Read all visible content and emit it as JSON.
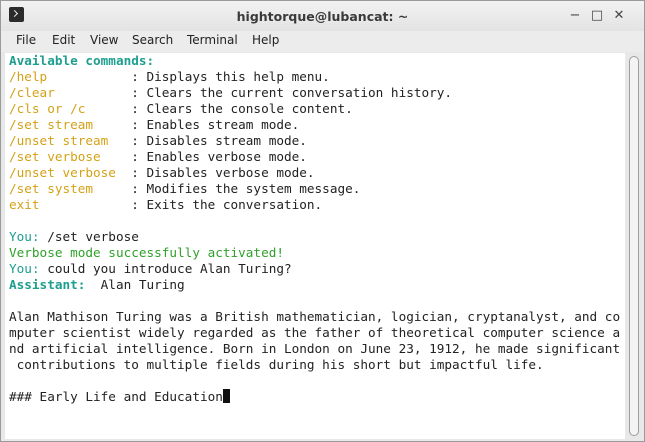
{
  "window": {
    "title": "hightorque@lubancat: ~",
    "controls": {
      "minimize": "−",
      "maximize": "□",
      "close": "✕"
    }
  },
  "menubar": [
    "File",
    "Edit",
    "View",
    "Search",
    "Terminal",
    "Help"
  ],
  "terminal": {
    "header": "Available commands:",
    "commands": [
      {
        "cmd": "/help           ",
        "desc": ": Displays this help menu."
      },
      {
        "cmd": "/clear          ",
        "desc": ": Clears the current conversation history."
      },
      {
        "cmd": "/cls or /c      ",
        "desc": ": Clears the console content."
      },
      {
        "cmd": "/set stream     ",
        "desc": ": Enables stream mode."
      },
      {
        "cmd": "/unset stream   ",
        "desc": ": Disables stream mode."
      },
      {
        "cmd": "/set verbose    ",
        "desc": ": Enables verbose mode."
      },
      {
        "cmd": "/unset verbose  ",
        "desc": ": Disables verbose mode."
      },
      {
        "cmd": "/set system     ",
        "desc": ": Modifies the system message."
      },
      {
        "cmd": "exit            ",
        "desc": ": Exits the conversation."
      }
    ],
    "you_label": "You:",
    "input1": " /set verbose",
    "verbose_msg": "Verbose mode successfully activated!",
    "input2": " could you introduce Alan Turing?",
    "assistant_label": "Assistant:",
    "assistant_text": "  Alan Turing",
    "paragraph": [
      "Alan Mathison Turing was a British mathematician, logician, cryptanalyst, and co",
      "mputer scientist widely regarded as the father of theoretical computer science a",
      "nd artificial intelligence. Born in London on June 23, 1912, he made significant",
      " contributions to multiple fields during his short but impactful life."
    ],
    "heading": "### Early Life and Education"
  },
  "colors": {
    "header": "#1e9e8e",
    "command": "#d4a217",
    "success": "#2fa12a"
  }
}
